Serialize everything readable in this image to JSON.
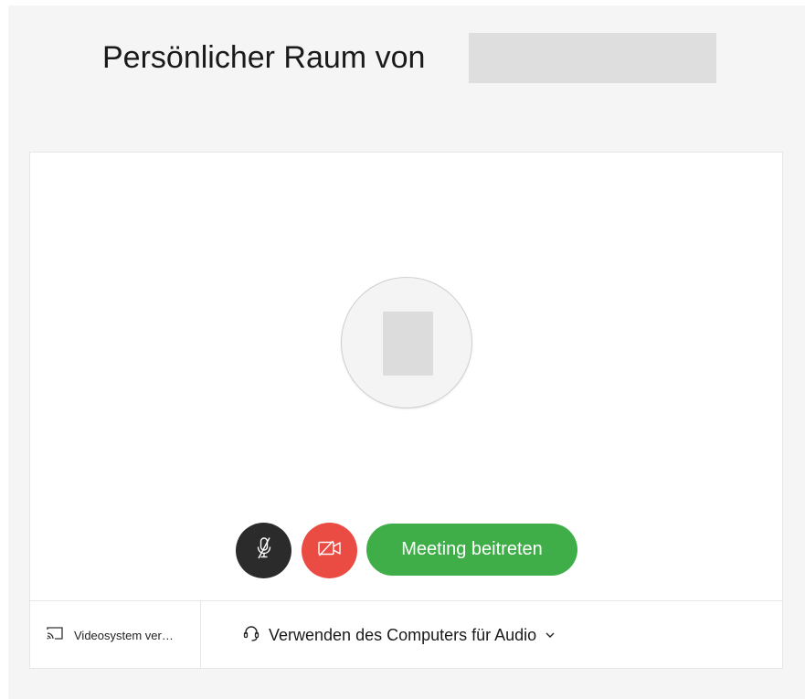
{
  "header": {
    "title": "Persönlicher Raum von"
  },
  "controls": {
    "join_label": "Meeting beitreten",
    "mute_icon": "microphone-muted-icon",
    "video_icon": "video-off-icon",
    "mute_color": "#2b2b2b",
    "video_color": "#ea4b43",
    "join_color": "#3fae49"
  },
  "footer": {
    "video_system_label": "Videosystem ver…",
    "video_system_icon": "cast-icon",
    "audio_label": "Verwenden des Computers für Audio",
    "audio_icon": "headset-icon",
    "audio_dropdown_icon": "chevron-down-icon"
  }
}
